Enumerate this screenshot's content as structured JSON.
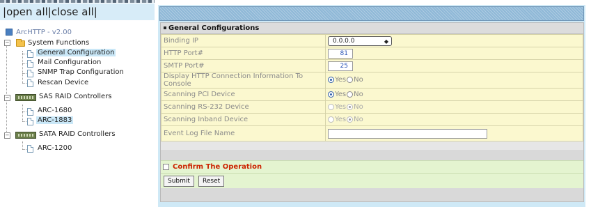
{
  "nav": {
    "open_all": "open all",
    "close_all": "close all",
    "sep_left": "|",
    "sep_mid": "|",
    "sep_right": "|"
  },
  "tree": {
    "root": "ArcHTTP - v2.00",
    "system_functions": "System Functions",
    "items": [
      "General Configuration",
      "Mail Configuration",
      "SNMP Trap Configuration",
      "Rescan Device"
    ],
    "sas_group": "SAS RAID Controllers",
    "sas_items": [
      "ARC-1680",
      "ARC-1883"
    ],
    "sata_group": "SATA RAID Controllers",
    "sata_items": [
      "ARC-1200"
    ]
  },
  "panel": {
    "title": "General Configurations",
    "rows": [
      {
        "label": "Binding IP",
        "value": "0.0.0.0"
      },
      {
        "label": "HTTP Port#",
        "value": "81"
      },
      {
        "label": "SMTP Port#",
        "value": "25"
      },
      {
        "label": "Display HTTP Connection Information To Console",
        "yes": "Yes",
        "no": "No",
        "selected": "Yes"
      },
      {
        "label": "Scanning PCI Device",
        "yes": "Yes",
        "no": "No",
        "selected": "Yes"
      },
      {
        "label": "Scanning RS-232 Device",
        "yes": "Yes",
        "no": "No",
        "selected": "No"
      },
      {
        "label": "Scanning Inband Device",
        "yes": "Yes",
        "no": "No",
        "selected": "No"
      },
      {
        "label": "Event Log File Name",
        "value": ""
      }
    ],
    "confirm": "Confirm The Operation",
    "submit": "Submit",
    "reset": "Reset"
  }
}
